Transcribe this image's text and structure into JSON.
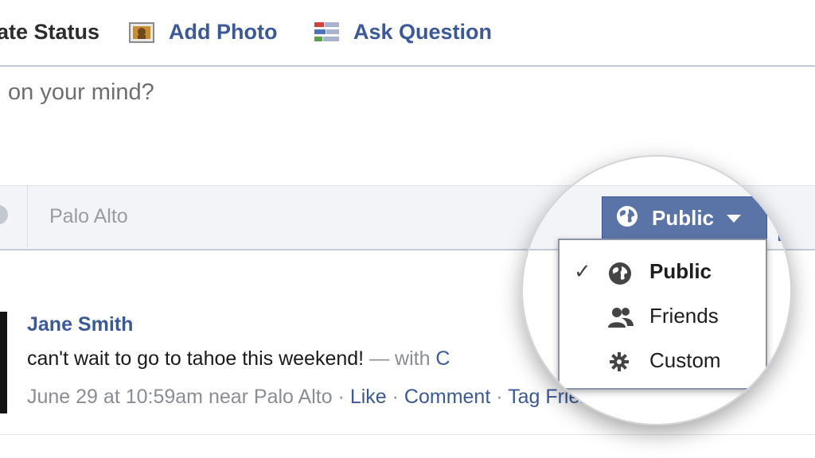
{
  "composer": {
    "tabs": [
      {
        "label": "ate Status",
        "icon": "status-icon"
      },
      {
        "label": "Add Photo",
        "icon": "photo-icon"
      },
      {
        "label": "Ask Question",
        "icon": "question-icon"
      }
    ],
    "placeholder": "on your mind?",
    "location": "Palo Alto",
    "privacy": {
      "selected": "Public",
      "options": [
        {
          "label": "Public",
          "icon": "globe-icon",
          "checked": true
        },
        {
          "label": "Friends",
          "icon": "friends-icon",
          "checked": false
        },
        {
          "label": "Custom",
          "icon": "gear-icon",
          "checked": false
        }
      ]
    }
  },
  "story": {
    "author": "Jane Smith",
    "text": "can't wait to go to tahoe this weekend!",
    "with_text": "— with",
    "tagged_partial": "C",
    "timestamp": "June 29 at 10:59am near Palo Alto",
    "separator": " · ",
    "actions": [
      "Like",
      "Comment",
      "Tag Friends"
    ]
  },
  "colors": {
    "link": "#3b5998",
    "button": "#5b74a8",
    "text_muted": "#8a8d93"
  }
}
